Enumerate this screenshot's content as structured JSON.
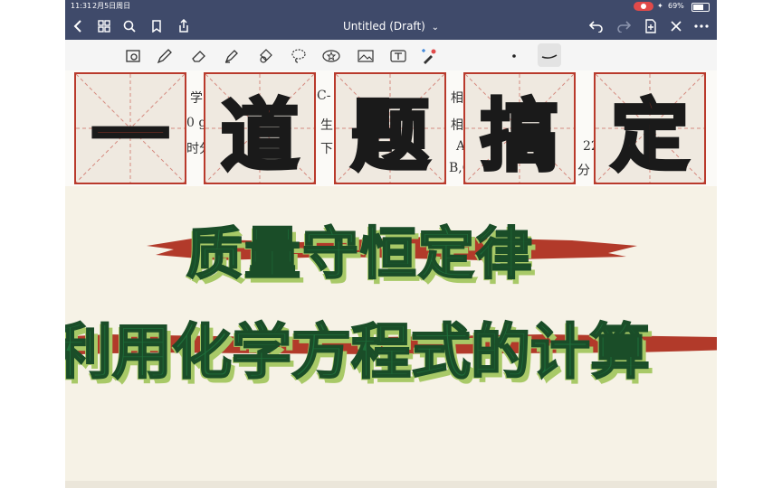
{
  "status_bar": {
    "time": "11:31",
    "date": "2月5日周日",
    "battery": "69%"
  },
  "nav": {
    "title": "Untitled (Draft)",
    "title_chevron": "⌄"
  },
  "toolbar": {
    "tools": [
      "lasso-zoom-icon",
      "pen-icon",
      "eraser-icon",
      "highlighter-icon",
      "shapes-icon",
      "lasso-icon",
      "sticker-icon",
      "image-icon",
      "text-icon",
      "laser-icon"
    ]
  },
  "background_text": {
    "row1": [
      "学",
      "C-",
      "相"
    ],
    "row2": [
      "0 g",
      "生",
      "相"
    ],
    "row3": [
      "时分",
      "下",
      "A",
      "22"
    ],
    "row4": [
      "B,C",
      "分"
    ]
  },
  "title_chars": [
    "一",
    "道",
    "题",
    "搞",
    "定"
  ],
  "headline1": "质量守恒定律",
  "headline2": "利用化学方程式的计算",
  "colors": {
    "nav_bg": "#3f4a6a",
    "paper": "#f6f2e6",
    "box_red": "#b93a2c",
    "green_text": "#1f6e3a",
    "green_shadow": "#a8c967",
    "brush_red": "#b23a2a"
  }
}
